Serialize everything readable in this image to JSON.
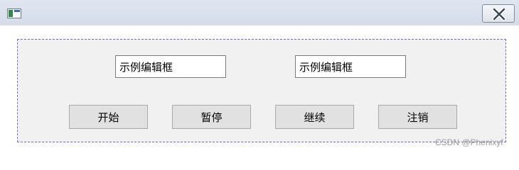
{
  "window": {
    "icon": "application-icon",
    "close_icon": "close-icon"
  },
  "edits": [
    {
      "value": "示例编辑框"
    },
    {
      "value": "示例编辑框"
    }
  ],
  "buttons": {
    "start": "开始",
    "pause": "暂停",
    "resume": "继续",
    "logout": "注销"
  },
  "watermark": "CSDN @Phenixyf",
  "colors": {
    "dialog_border": "#6c6cd8",
    "dialog_background": "#f1f1f1",
    "button_background": "#e1e1e1"
  }
}
